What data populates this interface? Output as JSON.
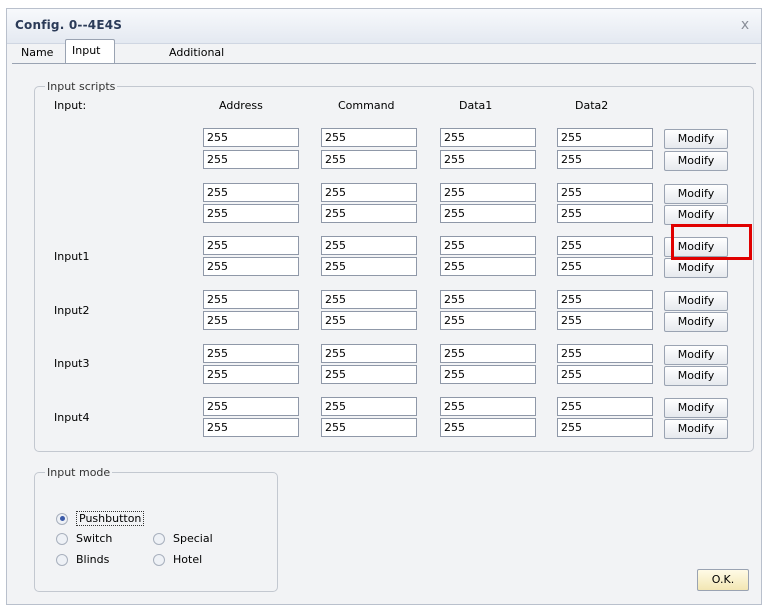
{
  "window": {
    "title": "Config. 0--4E4S",
    "close_glyph": "x"
  },
  "tabs": [
    {
      "label": "Name"
    },
    {
      "label": "Input scripts"
    },
    {
      "label": "Additional params."
    }
  ],
  "input_scripts": {
    "legend": "Input scripts",
    "input_header": "Input:",
    "columns": [
      "Address",
      "Command",
      "Data1",
      "Data2"
    ],
    "row_labels": [
      "Input1",
      "Input2",
      "Input3",
      "Input4"
    ],
    "field_value": "255",
    "modify_label": "Modify"
  },
  "input_mode": {
    "legend": "Input mode",
    "options": [
      {
        "label": "Pushbutton",
        "checked": true
      },
      {
        "label": "Switch",
        "checked": false
      },
      {
        "label": "Special",
        "checked": false
      },
      {
        "label": "Blinds",
        "checked": false
      },
      {
        "label": "Hotel",
        "checked": false
      }
    ]
  },
  "ok_label": "O.K.",
  "colors": {
    "highlight": "#e00000",
    "title": "#2b3b58"
  }
}
